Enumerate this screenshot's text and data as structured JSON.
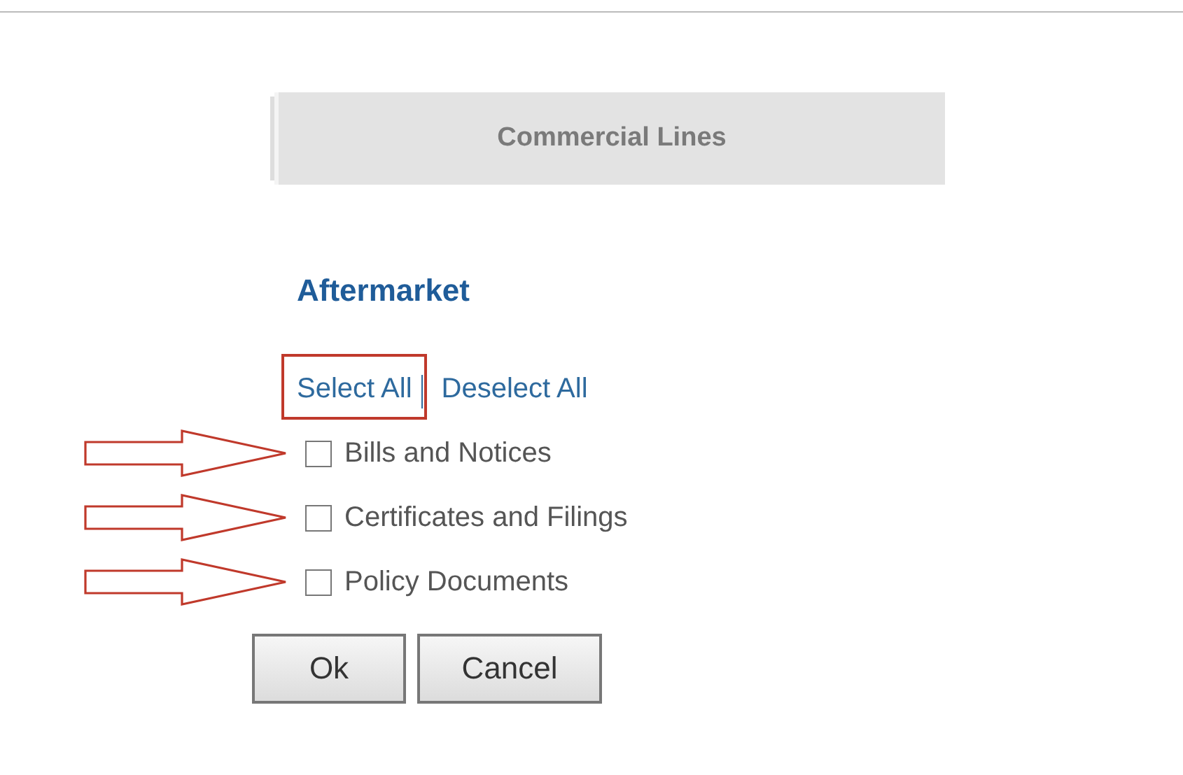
{
  "header": {
    "title": "Commercial Lines"
  },
  "section": {
    "title": "Aftermarket"
  },
  "links": [
    {
      "label": "Select All",
      "highlighted": true
    },
    {
      "label": "Deselect All",
      "highlighted": false
    }
  ],
  "options": [
    {
      "label": "Bills and Notices",
      "checked": false,
      "arrow": true
    },
    {
      "label": "Certificates and Filings",
      "checked": false,
      "arrow": true
    },
    {
      "label": "Policy Documents",
      "checked": false,
      "arrow": true
    }
  ],
  "buttons": [
    "Ok",
    "Cancel"
  ]
}
